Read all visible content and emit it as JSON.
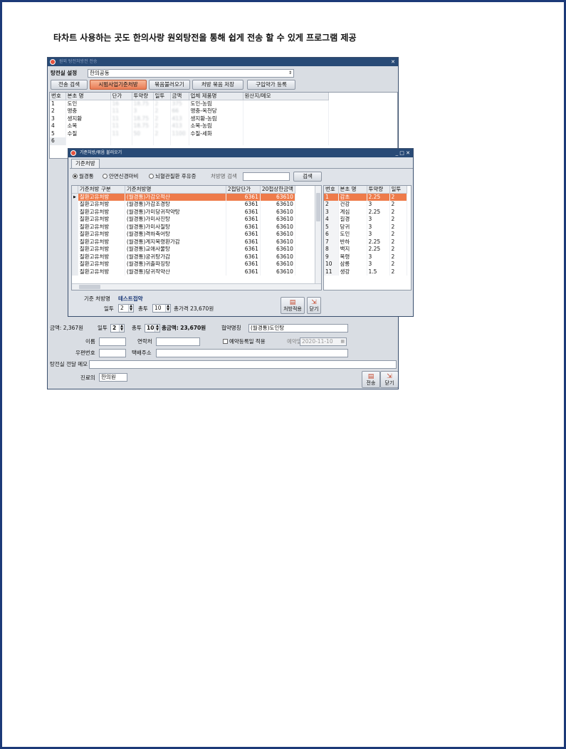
{
  "headline": "타차트 사용하는 곳도 한의사랑  원외탕전을 통해 쉽게 전송 할 수 있게 프로그램 제공",
  "main": {
    "title": "원외 탕전처방전 전송",
    "dispensary_label": "탕전실 설정",
    "dispensary_value": "한의공동",
    "buttons": {
      "search": "전송 검색",
      "pilot": "시범사업기준처방",
      "load_bundle": "묶음불러오기",
      "save_bundle": "처방 묶음 저장",
      "herb_register": "구입약가 등록"
    },
    "table": {
      "headers": [
        "번호",
        "본초 명",
        "단가",
        "투약량",
        "일투",
        "금액",
        "업체 제품명",
        "원산지/메모"
      ],
      "rows": [
        {
          "no": "1",
          "name": "도인",
          "price": "16",
          "qty": "18.75",
          "daily": "2",
          "amount": "375",
          "product": "도인-농림",
          "origin": ""
        },
        {
          "no": "2",
          "name": "맹충",
          "price": "11",
          "qty": "3",
          "daily": "2",
          "amount": "66",
          "product": "맹충-옥천당",
          "origin": ""
        },
        {
          "no": "3",
          "name": "생지황",
          "price": "11",
          "qty": "18.75",
          "daily": "2",
          "amount": "413",
          "product": "생지황-농림",
          "origin": ""
        },
        {
          "no": "4",
          "name": "소목",
          "price": "11",
          "qty": "18.75",
          "daily": "2",
          "amount": "413",
          "product": "소목-농림",
          "origin": ""
        },
        {
          "no": "5",
          "name": "수질",
          "price": "11",
          "qty": "50",
          "daily": "2",
          "amount": "1100",
          "product": "수질-세화",
          "origin": ""
        },
        {
          "no": "6",
          "name": "",
          "price": "",
          "qty": "",
          "daily": "",
          "amount": "",
          "product": "",
          "origin": ""
        }
      ]
    },
    "amount_label": "금액: 2,367원",
    "daily_label": "일투",
    "daily_value": "2",
    "total_label": "총투",
    "total_value": "10",
    "total_amount": "총금액: 23,670원",
    "agreement_label": "협약명칭",
    "agreement_value": "(월경통)도인탕",
    "name_label": "이름",
    "contact_label": "연락처",
    "reserve_check": "예약등록일 적용",
    "reserve_date_label": "예약일",
    "reserve_date_value": "2020-11-10",
    "zip_label": "우편번호",
    "address_label": "택배주소",
    "memo_label": "탕전실 전달 메모",
    "doctor_label": "진료의",
    "doctor_value": "한의원",
    "send_label": "전송",
    "close_label": "닫기"
  },
  "dialog": {
    "title": "기준처방/묶음 불러오기",
    "tab": "기준처방",
    "radios": [
      "월경통",
      "안면신경마비",
      "뇌혈관질환 후유증"
    ],
    "search_label": "처방명 검색",
    "search_button": "검색",
    "list_headers": [
      "기준처방 구분",
      "기준처방명",
      "2첩당단가",
      "20첩상한금액"
    ],
    "list_rows": [
      {
        "cat": "질환고유처방",
        "name": "(월경통)가감오적산",
        "unit": "6361",
        "cap": "63610"
      },
      {
        "cat": "질환고유처방",
        "name": "(월경통)가감조경탕",
        "unit": "6361",
        "cap": "63610"
      },
      {
        "cat": "질환고유처방",
        "name": "(월경통)가미당귀작약탕",
        "unit": "6361",
        "cap": "63610"
      },
      {
        "cat": "질환고유처방",
        "name": "(월경통)가미사진탕",
        "unit": "6361",
        "cap": "63610"
      },
      {
        "cat": "질환고유처방",
        "name": "(월경통)가미사칠탕",
        "unit": "6361",
        "cap": "63610"
      },
      {
        "cat": "질환고유처방",
        "name": "(월경통)격하축어탕",
        "unit": "6361",
        "cap": "63610"
      },
      {
        "cat": "질환고유처방",
        "name": "(월경통)계지복령환가감",
        "unit": "6361",
        "cap": "63610"
      },
      {
        "cat": "질환고유처방",
        "name": "(월경통)교애사물탕",
        "unit": "6361",
        "cap": "63610"
      },
      {
        "cat": "질환고유처방",
        "name": "(월경통)궁귀탕가감",
        "unit": "6361",
        "cap": "63610"
      },
      {
        "cat": "질환고유처방",
        "name": "(월경통)귀출파징탕",
        "unit": "6361",
        "cap": "63610"
      },
      {
        "cat": "질환고유처방",
        "name": "(월경통)당귀작약산",
        "unit": "6361",
        "cap": "63610"
      }
    ],
    "herb_headers": [
      "번호",
      "본초 명",
      "투약량",
      "일투"
    ],
    "herb_rows": [
      {
        "no": "1",
        "name": "감초",
        "qty": "2.25",
        "daily": "2"
      },
      {
        "no": "2",
        "name": "건강",
        "qty": "3",
        "daily": "2"
      },
      {
        "no": "3",
        "name": "계심",
        "qty": "2.25",
        "daily": "2"
      },
      {
        "no": "4",
        "name": "길경",
        "qty": "3",
        "daily": "2"
      },
      {
        "no": "5",
        "name": "당귀",
        "qty": "3",
        "daily": "2"
      },
      {
        "no": "6",
        "name": "도인",
        "qty": "3",
        "daily": "2"
      },
      {
        "no": "7",
        "name": "반하",
        "qty": "2.25",
        "daily": "2"
      },
      {
        "no": "8",
        "name": "백지",
        "qty": "2.25",
        "daily": "2"
      },
      {
        "no": "9",
        "name": "복령",
        "qty": "3",
        "daily": "2"
      },
      {
        "no": "10",
        "name": "삼릉",
        "qty": "3",
        "daily": "2"
      },
      {
        "no": "11",
        "name": "생강",
        "qty": "1.5",
        "daily": "2"
      }
    ],
    "base_label": "기준 처방명",
    "base_value": "테스트접약",
    "daily_label": "일투",
    "daily_value": "2",
    "total_label": "총투",
    "total_value": "10",
    "total_price": "총가격 23,670원",
    "apply_label": "처방적용",
    "close_label": "닫기"
  }
}
